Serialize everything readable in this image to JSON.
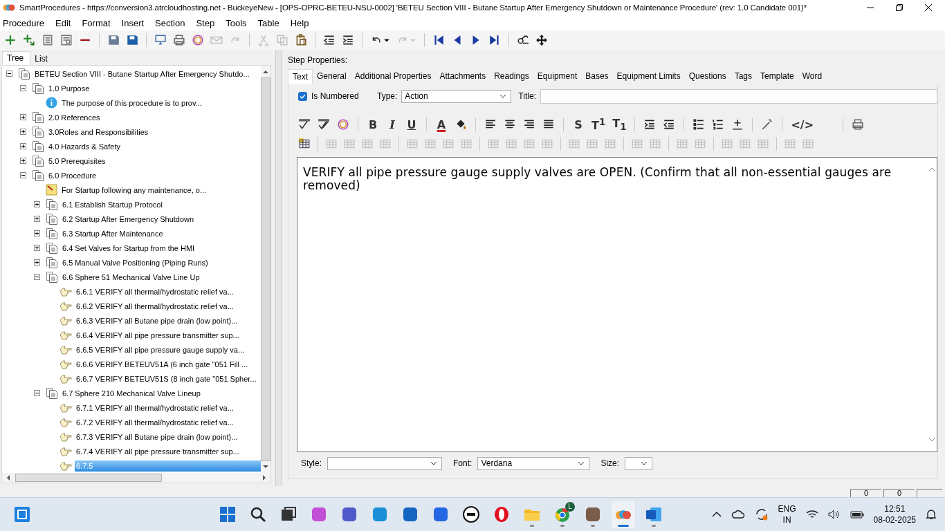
{
  "window": {
    "title": "SmartProcedures - https://conversion3.atrcloudhosting.net - BuckeyeNew - [OPS-OPRC-BETEU-NSU-0002] 'BETEU Section VIII - Butane Startup After Emergency Shutdown or Maintenance Procedure' (rev: 1.0 Candidate 001)*"
  },
  "menu": [
    {
      "label": "Procedure"
    },
    {
      "label": "Edit"
    },
    {
      "label": "Format"
    },
    {
      "label": "Insert"
    },
    {
      "label": "Section"
    },
    {
      "label": "Step"
    },
    {
      "label": "Tools"
    },
    {
      "label": "Table"
    },
    {
      "label": "Help"
    }
  ],
  "toolbar": [
    {
      "kind": "add",
      "disabled": false
    },
    {
      "kind": "add-sub",
      "disabled": false
    },
    {
      "kind": "document",
      "disabled": false
    },
    {
      "kind": "form",
      "disabled": false
    },
    {
      "kind": "remove",
      "disabled": false
    },
    {
      "kind": "separator"
    },
    {
      "kind": "save-as",
      "disabled": false
    },
    {
      "kind": "save",
      "disabled": false
    },
    {
      "kind": "separator"
    },
    {
      "kind": "monitor",
      "disabled": false
    },
    {
      "kind": "printer",
      "disabled": false
    },
    {
      "kind": "ring",
      "disabled": false
    },
    {
      "kind": "envelope",
      "disabled": true
    },
    {
      "kind": "redo",
      "disabled": true
    },
    {
      "kind": "separator"
    },
    {
      "kind": "cut",
      "disabled": true
    },
    {
      "kind": "copy",
      "disabled": true
    },
    {
      "kind": "paste",
      "disabled": false
    },
    {
      "kind": "separator"
    },
    {
      "kind": "outdent",
      "disabled": false
    },
    {
      "kind": "indent",
      "disabled": false
    },
    {
      "kind": "separator"
    },
    {
      "kind": "undo",
      "disabled": false
    },
    {
      "kind": "dropdown",
      "disabled": false
    },
    {
      "kind": "redo",
      "disabled": true
    },
    {
      "kind": "dropdown",
      "disabled": true
    },
    {
      "kind": "separator"
    },
    {
      "kind": "first",
      "disabled": false
    },
    {
      "kind": "prev",
      "disabled": false
    },
    {
      "kind": "next",
      "disabled": false
    },
    {
      "kind": "last",
      "disabled": false
    },
    {
      "kind": "separator"
    },
    {
      "kind": "find",
      "disabled": false
    },
    {
      "kind": "move",
      "disabled": false
    }
  ],
  "left_tabs": [
    {
      "label": "Tree",
      "selected": true
    },
    {
      "label": "List",
      "selected": false
    }
  ],
  "tree": [
    {
      "kind": "section",
      "label": "BETEU Section VIII - Butane Startup After Emergency Shutdo...",
      "expanded": true,
      "selected": false,
      "children": [
        {
          "kind": "section",
          "label": "1.0 Purpose",
          "expanded": true,
          "selected": false,
          "children": [
            {
              "kind": "info",
              "label": "The purpose of this procedure is to prov...",
              "selected": false
            }
          ]
        },
        {
          "kind": "section",
          "label": "2.0 References",
          "expanded": false,
          "selected": false
        },
        {
          "kind": "section",
          "label": "3.0Roles and Responsibilities",
          "expanded": false,
          "selected": false
        },
        {
          "kind": "section",
          "label": "4.0 Hazards & Safety",
          "expanded": false,
          "selected": false
        },
        {
          "kind": "section",
          "label": "5.0 Prerequisites",
          "expanded": false,
          "selected": false
        },
        {
          "kind": "section",
          "label": "6.0 Procedure",
          "expanded": true,
          "selected": false,
          "children": [
            {
              "kind": "note",
              "label": "For Startup following any maintenance, o...",
              "selected": false
            },
            {
              "kind": "section",
              "label": "6.1 Establish Startup Protocol",
              "expanded": false,
              "selected": false
            },
            {
              "kind": "section",
              "label": "6.2 Startup After Emergency Shutdown",
              "expanded": false,
              "selected": false
            },
            {
              "kind": "section",
              "label": "6.3 Startup After Maintenance",
              "expanded": false,
              "selected": false
            },
            {
              "kind": "section",
              "label": "6.4 Set Valves for Startup from the HMI",
              "expanded": false,
              "selected": false
            },
            {
              "kind": "section",
              "label": "6.5 Manual Valve Positioning (Piping Runs)",
              "expanded": false,
              "selected": false
            },
            {
              "kind": "section",
              "label": "6.6 Sphere 51 Mechanical Valve Line Up",
              "expanded": true,
              "selected": false,
              "children": [
                {
                  "kind": "step",
                  "label": "6.6.1 VERIFY all thermal/hydrostatic relief va...",
                  "selected": false
                },
                {
                  "kind": "step",
                  "label": "6.6.2 VERIFY all thermal/hydrostatic relief va...",
                  "selected": false
                },
                {
                  "kind": "step",
                  "label": "6.6.3 VERIFY all Butane pipe drain (low point)...",
                  "selected": false
                },
                {
                  "kind": "step",
                  "label": "6.6.4 VERIFY all pipe pressure transmitter sup...",
                  "selected": false
                },
                {
                  "kind": "step",
                  "label": "6.6.5 VERIFY all pipe pressure gauge supply va...",
                  "selected": false
                },
                {
                  "kind": "step",
                  "label": "6.6.6 VERIFY BETEUV51A (6 inch gate \"051 Fill ...",
                  "selected": false
                },
                {
                  "kind": "step",
                  "label": "6.6.7 VERIFY BETEUV51S (8 inch gate \"051 Spher...",
                  "selected": false
                }
              ]
            },
            {
              "kind": "section",
              "label": "6.7 Sphere 210 Mechanical Valve Lineup",
              "expanded": true,
              "selected": false,
              "children": [
                {
                  "kind": "step",
                  "label": "6.7.1 VERIFY all thermal/hydrostatic relief va...",
                  "selected": false
                },
                {
                  "kind": "step",
                  "label": "6.7.2 VERIFY all thermal/hydrostatic relief va...",
                  "selected": false
                },
                {
                  "kind": "step",
                  "label": "6.7.3 VERIFY all Butane pipe drain (low point)...",
                  "selected": false
                },
                {
                  "kind": "step",
                  "label": "6.7.4 VERIFY all pipe pressure transmitter sup...",
                  "selected": false
                },
                {
                  "kind": "step",
                  "label": "6.7.5",
                  "selected": true
                }
              ]
            }
          ]
        }
      ]
    }
  ],
  "step_properties": {
    "heading": "Step Properties:",
    "tabs": [
      {
        "label": "Text",
        "selected": true
      },
      {
        "label": "General",
        "selected": false
      },
      {
        "label": "Additional Properties",
        "selected": false
      },
      {
        "label": "Attachments",
        "selected": false
      },
      {
        "label": "Readings",
        "selected": false
      },
      {
        "label": "Equipment",
        "selected": false
      },
      {
        "label": "Bases",
        "selected": false
      },
      {
        "label": "Equipment Limits",
        "selected": false
      },
      {
        "label": "Questions",
        "selected": false
      },
      {
        "label": "Tags",
        "selected": false
      },
      {
        "label": "Template",
        "selected": false
      },
      {
        "label": "Word",
        "selected": false
      }
    ],
    "is_numbered": {
      "label": "Is Numbered",
      "checked": true
    },
    "type": {
      "label": "Type:",
      "value": "Action"
    },
    "title": {
      "label": "Title:"
    },
    "format_toolbar": [
      {
        "kind": "spell",
        "disabled": false
      },
      {
        "kind": "spell-all",
        "disabled": false
      },
      {
        "kind": "ring",
        "disabled": false
      },
      {
        "kind": "separator"
      },
      {
        "kind": "glyph",
        "glyph": "B",
        "disabled": false
      },
      {
        "kind": "glyph",
        "glyph": "I",
        "disabled": false
      },
      {
        "kind": "glyph",
        "glyph": "U",
        "disabled": false
      },
      {
        "kind": "separator"
      },
      {
        "kind": "glyph",
        "glyph": "A",
        "disabled": false
      },
      {
        "kind": "bucket",
        "disabled": false
      },
      {
        "kind": "separator"
      },
      {
        "kind": "align-left",
        "disabled": false
      },
      {
        "kind": "align-center",
        "disabled": false
      },
      {
        "kind": "align-right",
        "disabled": false
      },
      {
        "kind": "justify",
        "disabled": false
      },
      {
        "kind": "separator"
      },
      {
        "kind": "glyph",
        "glyph": "S",
        "disabled": false
      },
      {
        "kind": "glyph",
        "glyph": "T$^{1}$",
        "disabled": false
      },
      {
        "kind": "glyph",
        "glyph": "T$_{1}$",
        "disabled": false
      },
      {
        "kind": "separator"
      },
      {
        "kind": "indent",
        "disabled": false
      },
      {
        "kind": "outdent",
        "disabled": false
      },
      {
        "kind": "separator"
      },
      {
        "kind": "bullets",
        "disabled": false
      },
      {
        "kind": "numbers",
        "disabled": false
      },
      {
        "kind": "rule",
        "disabled": false
      },
      {
        "kind": "separator"
      },
      {
        "kind": "wand",
        "disabled": false
      },
      {
        "kind": "separator"
      },
      {
        "kind": "glyph",
        "glyph": "</>",
        "disabled": false
      },
      {
        "kind": "gap"
      },
      {
        "kind": "separator"
      },
      {
        "kind": "printer",
        "disabled": false
      }
    ],
    "table_toolbar": [
      {
        "kind": "table",
        "disabled": false
      },
      {
        "kind": "separator"
      },
      {
        "kind": "table",
        "disabled": true
      },
      {
        "kind": "table",
        "disabled": true
      },
      {
        "kind": "table",
        "disabled": true
      },
      {
        "kind": "table",
        "disabled": true
      },
      {
        "kind": "separator"
      },
      {
        "kind": "table",
        "disabled": true
      },
      {
        "kind": "table",
        "disabled": true
      },
      {
        "kind": "table",
        "disabled": true
      },
      {
        "kind": "table",
        "disabled": true
      },
      {
        "kind": "separator"
      },
      {
        "kind": "table",
        "disabled": true
      },
      {
        "kind": "table",
        "disabled": true
      },
      {
        "kind": "table",
        "disabled": true
      },
      {
        "kind": "table",
        "disabled": true
      },
      {
        "kind": "separator"
      },
      {
        "kind": "table",
        "disabled": true
      },
      {
        "kind": "table",
        "disabled": true
      },
      {
        "kind": "table",
        "disabled": true
      },
      {
        "kind": "separator"
      },
      {
        "kind": "table",
        "disabled": true
      },
      {
        "kind": "table",
        "disabled": true
      },
      {
        "kind": "separator"
      },
      {
        "kind": "table",
        "disabled": true
      },
      {
        "kind": "table",
        "disabled": true
      },
      {
        "kind": "separator"
      },
      {
        "kind": "table",
        "disabled": true
      },
      {
        "kind": "table",
        "disabled": true
      },
      {
        "kind": "table",
        "disabled": true
      },
      {
        "kind": "separator"
      },
      {
        "kind": "table",
        "disabled": true
      },
      {
        "kind": "table",
        "disabled": true
      }
    ],
    "text": "VERIFY all pipe pressure gauge supply valves are OPEN. (Confirm that all non-essential gauges are removed)",
    "style": {
      "label": "Style:"
    },
    "font": {
      "label": "Font:",
      "value": "Verdana"
    },
    "size": {
      "label": "Size:"
    }
  },
  "status_bar": [
    "0",
    "0"
  ],
  "taskbar": {
    "apps": [
      {
        "kind": "start",
        "running": false,
        "active": false
      },
      {
        "kind": "search",
        "running": false,
        "active": false
      },
      {
        "kind": "task-view",
        "running": false,
        "active": false
      },
      {
        "kind": "copilot",
        "running": false,
        "active": false
      },
      {
        "kind": "teams",
        "running": false,
        "active": false
      },
      {
        "kind": "edge",
        "running": false,
        "active": false
      },
      {
        "kind": "store",
        "running": false,
        "active": false
      },
      {
        "kind": "automate",
        "running": false,
        "active": false
      },
      {
        "kind": "dell",
        "running": false,
        "active": false
      },
      {
        "kind": "opera",
        "running": false,
        "active": false
      },
      {
        "kind": "folder",
        "running": true,
        "active": false
      },
      {
        "kind": "chrome",
        "running": true,
        "active": false,
        "badge": "L"
      },
      {
        "kind": "contacts",
        "running": true,
        "active": false
      },
      {
        "kind": "smartprocedures",
        "running": true,
        "active": true
      },
      {
        "kind": "word",
        "running": true,
        "active": false
      }
    ],
    "tray": {
      "language": "ENG",
      "region": "IN",
      "time": "12:51",
      "date": "08-02-2025"
    }
  }
}
